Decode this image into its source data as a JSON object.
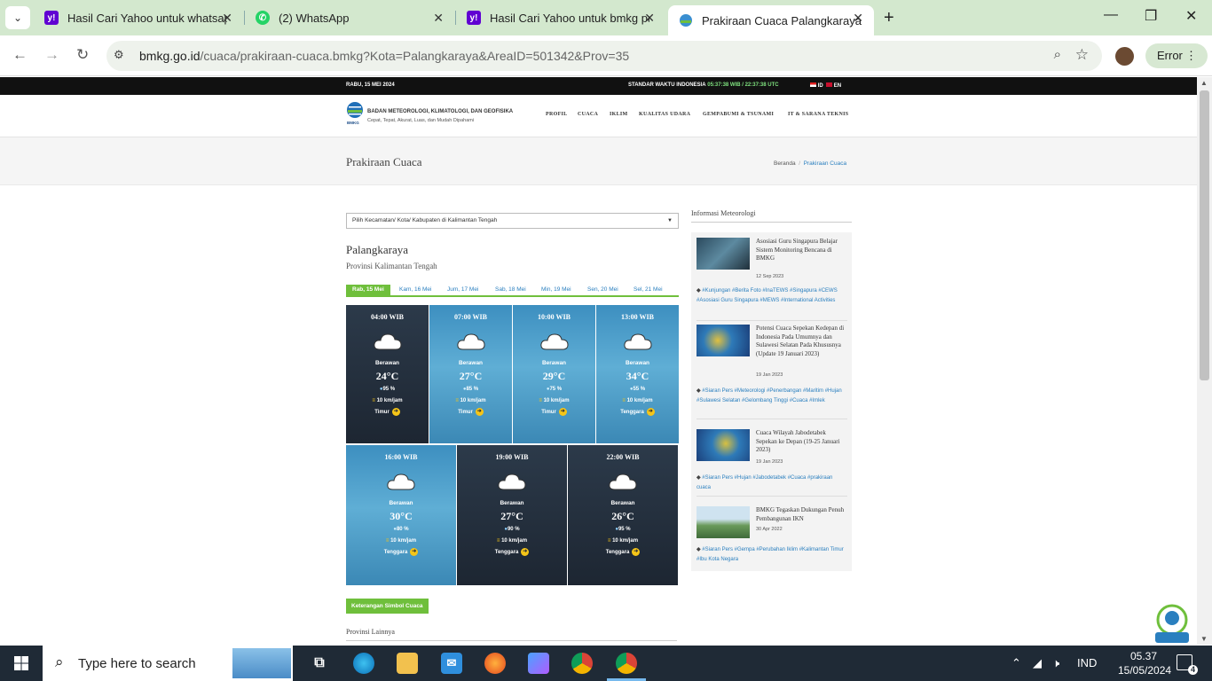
{
  "browser": {
    "tabs": [
      {
        "title": "Hasil Cari Yahoo untuk whatsap",
        "icon": "yahoo-icon"
      },
      {
        "title": "(2) WhatsApp",
        "icon": "whatsapp-icon"
      },
      {
        "title": "Hasil Cari Yahoo untuk bmkg pa",
        "icon": "yahoo-icon"
      },
      {
        "title": "Prakiraan Cuaca Palangkaraya -",
        "icon": "bmkg-icon"
      }
    ],
    "url_domain": "bmkg.go.id",
    "url_path": "/cuaca/prakiraan-cuaca.bmkg?Kota=Palangkaraya&AreaID=501342&Prov=35",
    "profile_button": "Error"
  },
  "site": {
    "date": "RABU, 15 MEI 2024",
    "std_time_label": "STANDAR WAKTU INDONESIA",
    "std_time_value": "05:37:38 WIB / 22:37:38 UTC",
    "lang_id": "ID",
    "lang_en": "EN",
    "org_name": "BADAN METEOROLOGI, KLIMATOLOGI, DAN GEOFISIKA",
    "tagline": "Cepat, Tepat, Akurat, Luas, dan Mudah Dipahami",
    "logo_text": "BMKG",
    "menu": [
      "PROFIL",
      "CUACA",
      "IKLIM",
      "KUALITAS UDARA",
      "GEMPABUMI & TSUNAMI",
      "IT & SARANA TEKNIS"
    ]
  },
  "page": {
    "title": "Prakiraan Cuaca",
    "breadcrumb_home": "Beranda",
    "breadcrumb_sep": "/",
    "breadcrumb_current": "Prakiraan Cuaca",
    "select_placeholder": "Pilih Kecamatan/ Kota/ Kabupaten di Kalimantan Tengah",
    "city": "Palangkaraya",
    "province": "Provinsi Kalimantan Tengah",
    "days": [
      "Rab, 15 Mei",
      "Kam, 16 Mei",
      "Jum, 17 Mei",
      "Sab, 18 Mei",
      "Min, 19 Mei",
      "Sen, 20 Mei",
      "Sel, 21 Mei"
    ],
    "forecasts": [
      {
        "time": "04:00 WIB",
        "condition": "Berawan",
        "temp": "24°C",
        "humidity": "95 %",
        "wind": "10 km/jam",
        "direction": "Timur"
      },
      {
        "time": "07:00 WIB",
        "condition": "Berawan",
        "temp": "27°C",
        "humidity": "85 %",
        "wind": "10 km/jam",
        "direction": "Timur"
      },
      {
        "time": "10:00 WIB",
        "condition": "Berawan",
        "temp": "29°C",
        "humidity": "75 %",
        "wind": "10 km/jam",
        "direction": "Timur"
      },
      {
        "time": "13:00 WIB",
        "condition": "Berawan",
        "temp": "34°C",
        "humidity": "55 %",
        "wind": "10 km/jam",
        "direction": "Tenggara"
      },
      {
        "time": "16:00 WIB",
        "condition": "Berawan",
        "temp": "30°C",
        "humidity": "80 %",
        "wind": "10 km/jam",
        "direction": "Tenggara"
      },
      {
        "time": "19:00 WIB",
        "condition": "Berawan",
        "temp": "27°C",
        "humidity": "90 %",
        "wind": "10 km/jam",
        "direction": "Tenggara"
      },
      {
        "time": "22:00 WIB",
        "condition": "Berawan",
        "temp": "26°C",
        "humidity": "95 %",
        "wind": "10 km/jam",
        "direction": "Tenggara"
      }
    ],
    "legend_button": "Keterangan Simbol Cuaca",
    "other_provinces": "Provinsi Lainnya"
  },
  "sidebar": {
    "title": "Informasi Meteorologi",
    "news": [
      {
        "headline": "Asosiasi Guru Singapura Belajar Sistem Monitoring Bencana di BMKG",
        "date": "12 Sep 2023",
        "tags": "#Kunjungan #Berita Foto #InaTEWS #Singapura #CEWS #Asosiasi Guru Singapura #MEWS #International Activities"
      },
      {
        "headline": "Potensi Cuaca Sepekan Kedepan di Indonesia Pada Umumnya dan Sulawesi Selatan Pada Khususnya (Update 19 Januari 2023)",
        "date": "19 Jan 2023",
        "tags": "#Siaran Pers #Meteorologi #Penerbangan #Maritim #Hujan #Sulawesi Selatan #Gelombang Tinggi #Cuaca #Imlek"
      },
      {
        "headline": "Cuaca Wilayah Jabodetabek Sepekan ke Depan (19-25 Januari 2023)",
        "date": "19 Jan 2023",
        "tags": "#Siaran Pers #Hujan #Jabodetabek #Cuaca #prakiraan cuaca"
      },
      {
        "headline": "BMKG Tegaskan Dukungan Penuh Pembangunan IKN",
        "date": "30 Apr 2022",
        "tags": "#Siaran Pers #Gempa #Perubahan Iklim #Kalimantan Timur #Ibu Kota Negara"
      }
    ]
  },
  "taskbar": {
    "search_placeholder": "Type here to search",
    "lang": "IND",
    "time": "05.37",
    "date": "15/05/2024",
    "notifications": "4"
  }
}
